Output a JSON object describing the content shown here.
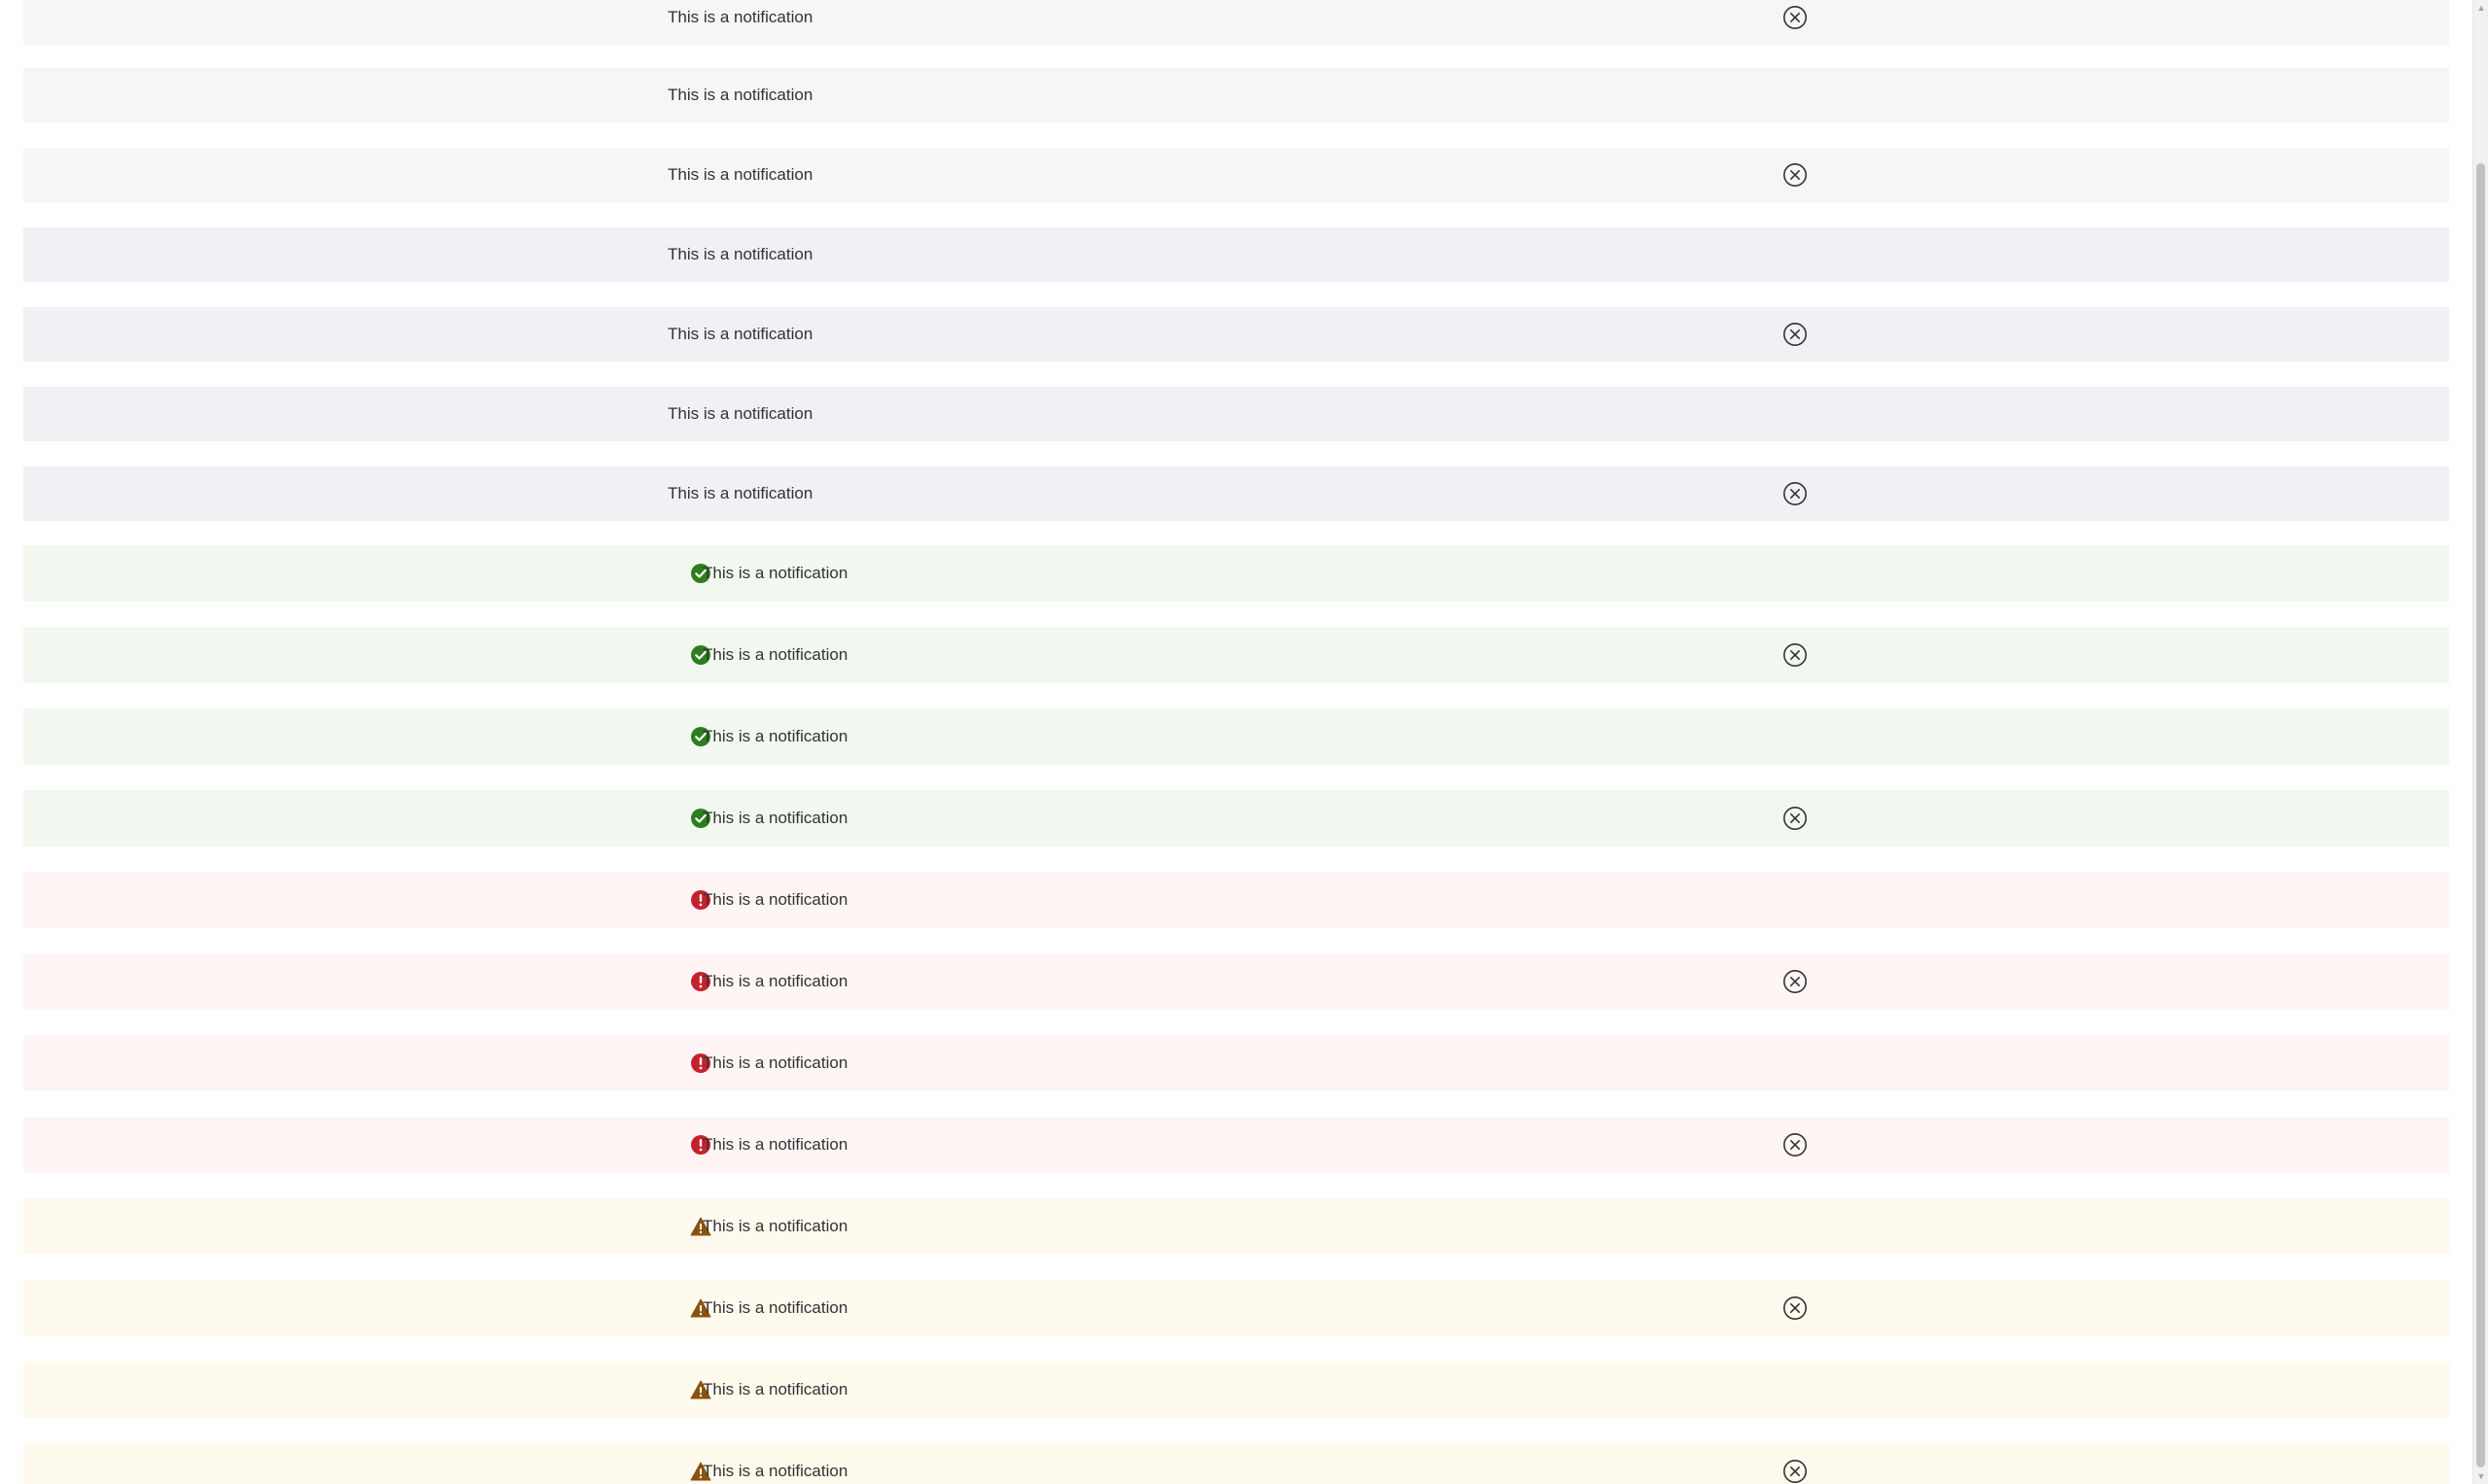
{
  "notification_text": "This is a notification",
  "colors": {
    "neutral": "#f6f6f6",
    "info": "#f1f0f5",
    "success": "#f2f8f0",
    "error": "#fff5f5",
    "warning": "#fff9ee",
    "success_icon": "#2d7e1e",
    "error_icon": "#c3222d",
    "warning_icon": "#8a5210"
  },
  "notifications": [
    {
      "variant": "neutral",
      "text": "This is a notification",
      "icon": "",
      "dismissible": true
    },
    {
      "variant": "neutral",
      "text": "This is a notification",
      "icon": "",
      "dismissible": false
    },
    {
      "variant": "neutral",
      "text": "This is a notification",
      "icon": "",
      "dismissible": true
    },
    {
      "variant": "info",
      "text": "This is a notification",
      "icon": "",
      "dismissible": false
    },
    {
      "variant": "info",
      "text": "This is a notification",
      "icon": "",
      "dismissible": true
    },
    {
      "variant": "info",
      "text": "This is a notification",
      "icon": "",
      "dismissible": false
    },
    {
      "variant": "info",
      "text": "This is a notification",
      "icon": "",
      "dismissible": true
    },
    {
      "variant": "success",
      "text": "This is a notification",
      "icon": "check-circle-icon",
      "dismissible": false
    },
    {
      "variant": "success",
      "text": "This is a notification",
      "icon": "check-circle-icon",
      "dismissible": true
    },
    {
      "variant": "success",
      "text": "This is a notification",
      "icon": "check-circle-icon",
      "dismissible": false
    },
    {
      "variant": "success",
      "text": "This is a notification",
      "icon": "check-circle-icon",
      "dismissible": true
    },
    {
      "variant": "error",
      "text": "This is a notification",
      "icon": "error-circle-icon",
      "dismissible": false
    },
    {
      "variant": "error",
      "text": "This is a notification",
      "icon": "error-circle-icon",
      "dismissible": true
    },
    {
      "variant": "error",
      "text": "This is a notification",
      "icon": "error-circle-icon",
      "dismissible": false
    },
    {
      "variant": "error",
      "text": "This is a notification",
      "icon": "error-circle-icon",
      "dismissible": true
    },
    {
      "variant": "warning",
      "text": "This is a notification",
      "icon": "warning-triangle-icon",
      "dismissible": false
    },
    {
      "variant": "warning",
      "text": "This is a notification",
      "icon": "warning-triangle-icon",
      "dismissible": true
    },
    {
      "variant": "warning",
      "text": "This is a notification",
      "icon": "warning-triangle-icon",
      "dismissible": false
    },
    {
      "variant": "warning",
      "text": "This is a notification",
      "icon": "warning-triangle-icon",
      "dismissible": true
    }
  ],
  "close_icon": "close-circle-icon",
  "scrollbar": {
    "up_arrow": "▲",
    "down_arrow": "▼"
  }
}
